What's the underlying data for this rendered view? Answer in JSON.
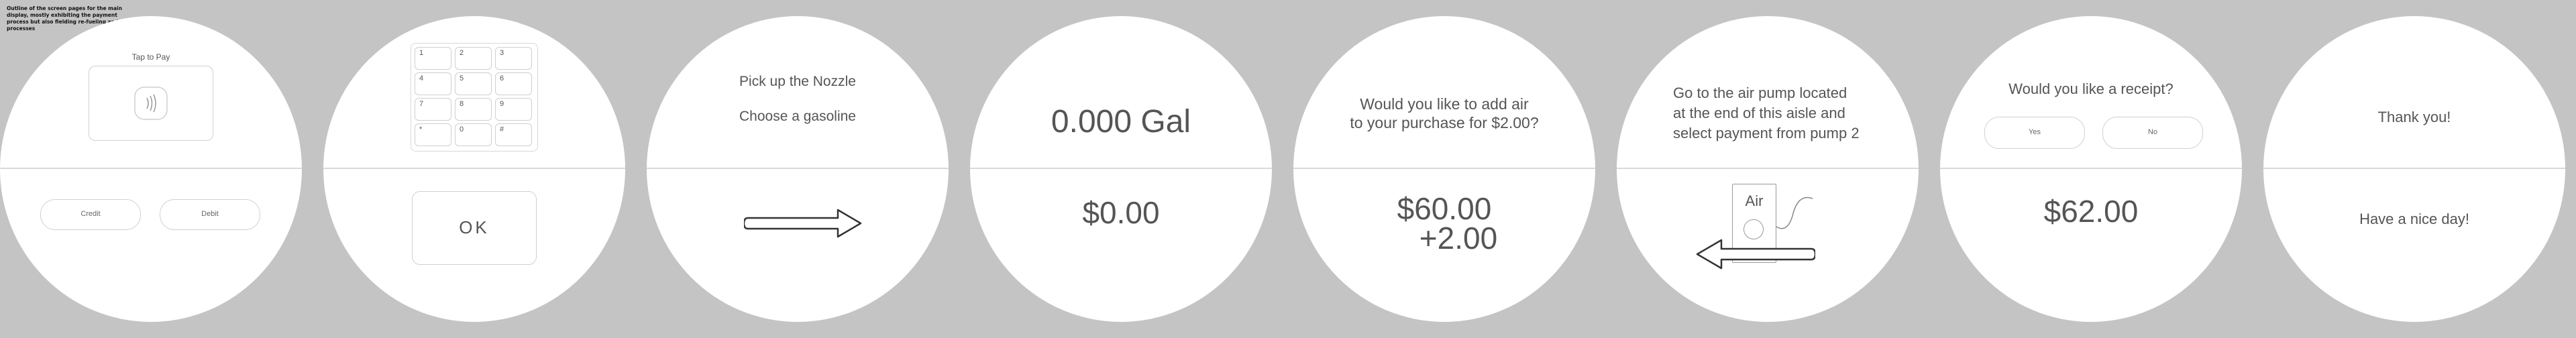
{
  "caption": "Outline of the screen pages for the main display, mostly exhibiting the payment process but also fielding re-fueling and air processes",
  "screens": [
    {
      "title": "Tap to Pay",
      "buttons": [
        "Credit",
        "Debit"
      ]
    },
    {
      "keys": [
        "1",
        "2",
        "3",
        "4",
        "5",
        "6",
        "7",
        "8",
        "9",
        "*",
        "0",
        "#"
      ],
      "ok": "OK"
    },
    {
      "line1": "Pick up the Nozzle",
      "line2": "Choose a gasoline"
    },
    {
      "gallons": "0.000 Gal",
      "price": "$0.00"
    },
    {
      "line1": "Would you like to add air",
      "line2": "to your purchase for $2.00?",
      "amount": "$60.00",
      "add": "+2.00"
    },
    {
      "line1": "Go to the air pump located",
      "line2": "at the end of this aisle and",
      "line3": "select payment from pump 2",
      "pump_label": "Air"
    },
    {
      "question": "Would you like a receipt?",
      "yes": "Yes",
      "no": "No",
      "total": "$62.00"
    },
    {
      "thanks": "Thank you!",
      "goodbye": "Have a nice day!"
    }
  ]
}
